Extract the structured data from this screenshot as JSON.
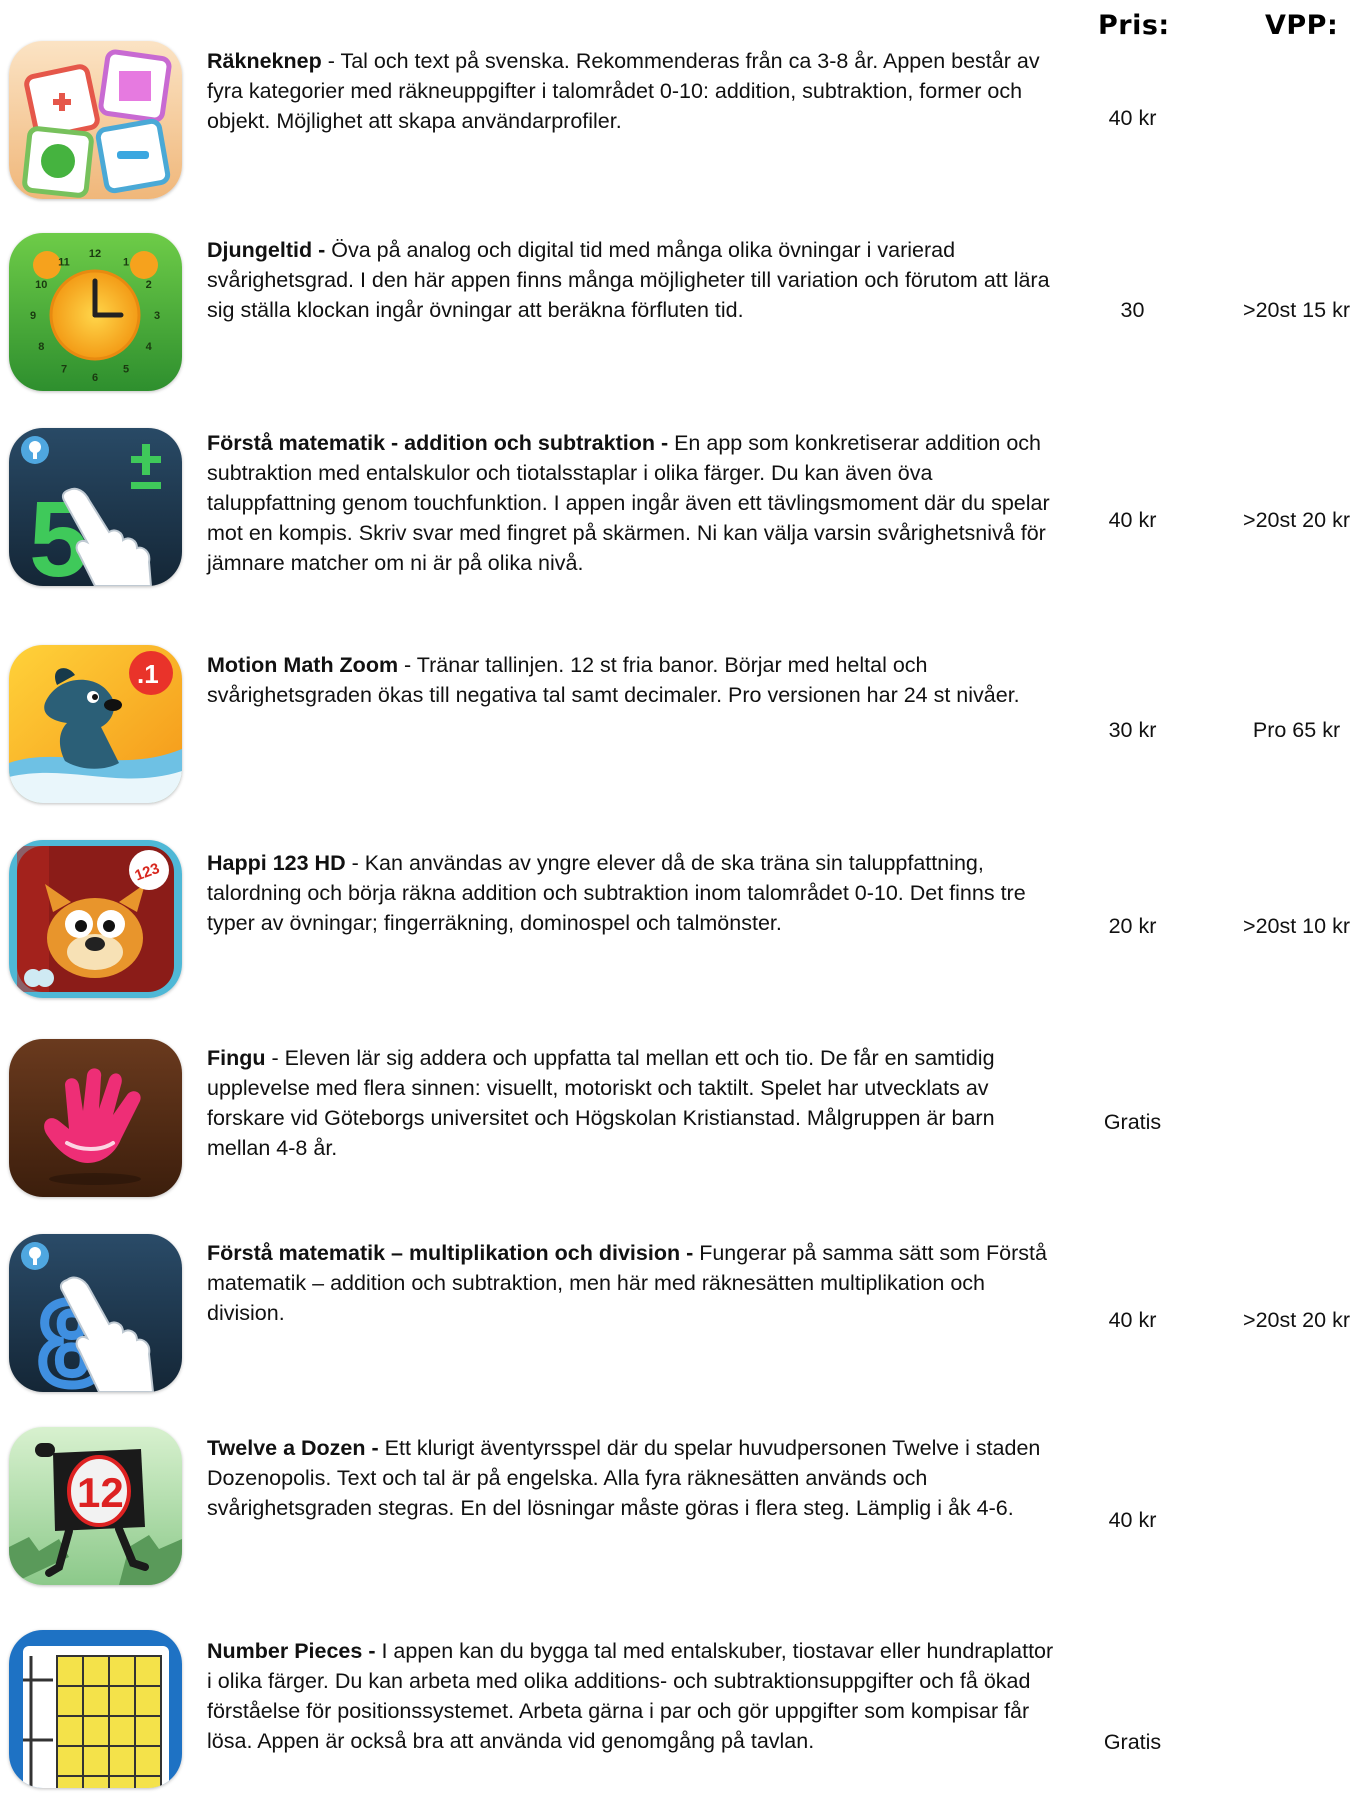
{
  "header": {
    "price_label": "Pris:",
    "vpp_label": "VPP:"
  },
  "apps": [
    {
      "name": "Räkneknep",
      "sep": " - ",
      "description": "Tal och text på svenska. Rekommenderas från ca 3-8 år. Appen består av fyra kategorier med räkneuppgifter i talområdet 0-10: addition, subtraktion, former och objekt. Möjlighet att skapa användarprofiler.",
      "price": "40 kr",
      "vpp": "",
      "icon": "plus-minus-cards-icon"
    },
    {
      "name": "Djungeltid -",
      "sep": " ",
      "description": "Öva på analog och digital tid med många olika övningar i varierad svårighetsgrad. I den här appen finns många möjligheter till variation och förutom att lära sig ställa klockan ingår övningar att beräkna förfluten tid.",
      "price": "30",
      "vpp": ">20st 15 kr",
      "icon": "clock-icon",
      "clock_numbers": [
        "12",
        "1",
        "2",
        "3",
        "4",
        "5",
        "6",
        "7",
        "8",
        "9",
        "10",
        "11"
      ]
    },
    {
      "name": "Förstå matematik - addition och subtraktion -",
      "sep": " ",
      "description": "En app som konkretiserar addition och subtraktion med entalskulor och tiotalsstaplar i olika färger. Du kan även öva taluppfattning genom touchfunktion. I appen ingår även ett tävlingsmoment där du spelar mot en kompis. Skriv svar med fingret på skärmen. Ni kan välja varsin svårighetsnivå för jämnare matcher om ni är på olika nivå.",
      "price": "40 kr",
      "vpp": ">20st 20 kr",
      "icon": "five-plus-minus-finger-icon",
      "icon_text": "5"
    },
    {
      "name": "Motion Math Zoom",
      "sep": " - ",
      "description": "Tränar tallinjen. 12 st fria banor. Börjar med heltal och svårighetsgraden ökas till negativa tal samt decimaler. Pro versionen har 24 st nivåer.",
      "price": "30 kr",
      "vpp": "Pro 65 kr",
      "icon": "zoom-dog-icon",
      "icon_text": ".1"
    },
    {
      "name": "Happi 123 HD",
      "sep": " - ",
      "description": "Kan användas av yngre elever då de ska träna sin taluppfattning, talordning och börja räkna addition och subtraktion inom talområdet  0-10. Det finns tre typer av övningar; fingerräkning, dominospel och talmönster.",
      "price": "20 kr",
      "vpp": ">20st 10 kr",
      "icon": "happi-monster-icon",
      "icon_text": "123"
    },
    {
      "name": "Fingu",
      "sep": " - ",
      "description": "Eleven lär sig addera och uppfatta tal mellan ett och tio. De får en samtidig upplevelse med flera sinnen: visuellt, motoriskt och taktilt. Spelet har utvecklats av forskare vid Göteborgs universitet och Högskolan Kristianstad. Målgruppen är barn mellan 4-8 år.",
      "price": "Gratis",
      "vpp": "",
      "icon": "pink-hand-icon"
    },
    {
      "name": "Förstå matematik – multiplikation och division -",
      "sep": " ",
      "description": "Fungerar på samma sätt som Förstå matematik – addition och subtraktion, men här med räknesätten multiplikation och division.",
      "price": "40 kr",
      "vpp": ">20st 20 kr",
      "icon": "eight-finger-icon",
      "icon_text": "8"
    },
    {
      "name": "Twelve a Dozen -",
      "sep": " ",
      "description": "Ett klurigt äventyrsspel där du spelar huvudpersonen Twelve i staden Dozenopolis. Text och tal är på engelska. Alla fyra räknesätten används och svårighetsgraden stegras. En del lösningar måste göras i flera steg. Lämplig i åk 4-6.",
      "price": "40 kr",
      "vpp": "",
      "icon": "twelve-character-icon",
      "icon_text": "12"
    },
    {
      "name": "Number Pieces -",
      "sep": " ",
      "description": "I appen kan du bygga tal med entalskuber, tiostavar eller hundraplattor i olika färger. Du kan arbeta med olika additions- och subtraktionsuppgifter och få ökad förståelse för positionssystemet. Arbeta gärna i par och gör uppgifter som kompisar får lösa. Appen är också bra att använda vid genomgång på tavlan.",
      "price": "Gratis",
      "vpp": "",
      "icon": "grid-pieces-icon"
    }
  ]
}
